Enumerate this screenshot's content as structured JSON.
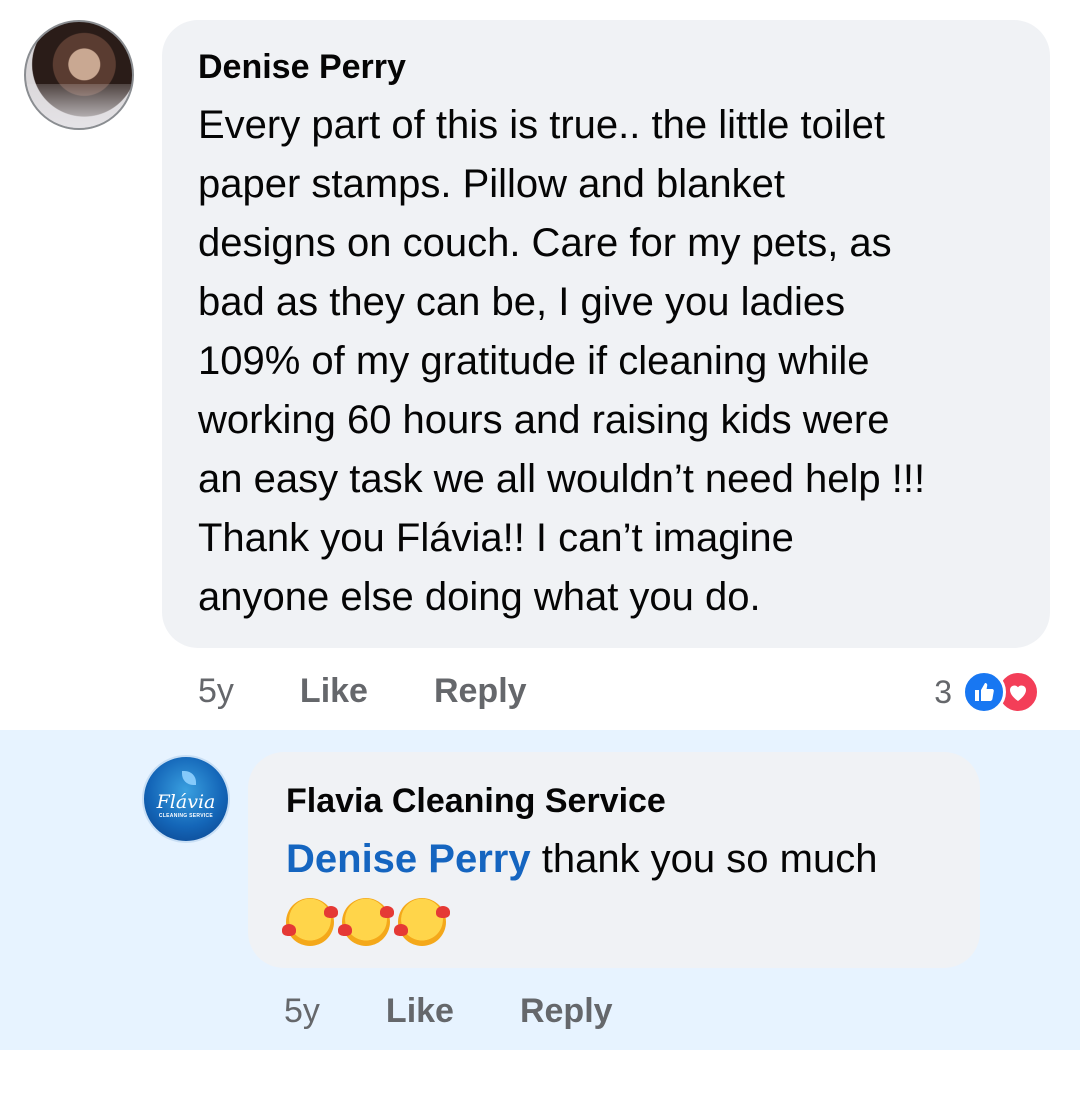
{
  "comments": [
    {
      "author": "Denise Perry",
      "lines": [
        "Every part of this is true.. the little toilet",
        "paper stamps. Pillow and blanket",
        "designs on couch. Care for my pets, as",
        "bad as they can be, I give you ladies",
        "109% of my gratitude if cleaning while",
        "working 60 hours and raising kids were",
        "an easy task we all wouldn’t need help !!!",
        "Thank you Flávia!! I can’t imagine",
        "anyone else doing what you do."
      ],
      "time": "5y",
      "like_label": "Like",
      "reply_label": "Reply",
      "reaction_count": "3",
      "reactions": [
        "like-icon",
        "love-icon"
      ]
    },
    {
      "author": "Flavia Cleaning Service",
      "logo_text": "Flávia",
      "logo_subtext": "CLEANING SERVICE",
      "mention": "Denise Perry",
      "text": " thank you so much",
      "emojis": [
        "smiling-face-with-hearts-icon",
        "smiling-face-with-hearts-icon",
        "smiling-face-with-hearts-icon"
      ],
      "time": "5y",
      "like_label": "Like",
      "reply_label": "Reply"
    }
  ],
  "colors": {
    "mention": "#1565c0",
    "reply_highlight": "#e7f3ff",
    "bubble": "#f0f2f5",
    "like": "#1877f2",
    "love": "#f33e58"
  }
}
